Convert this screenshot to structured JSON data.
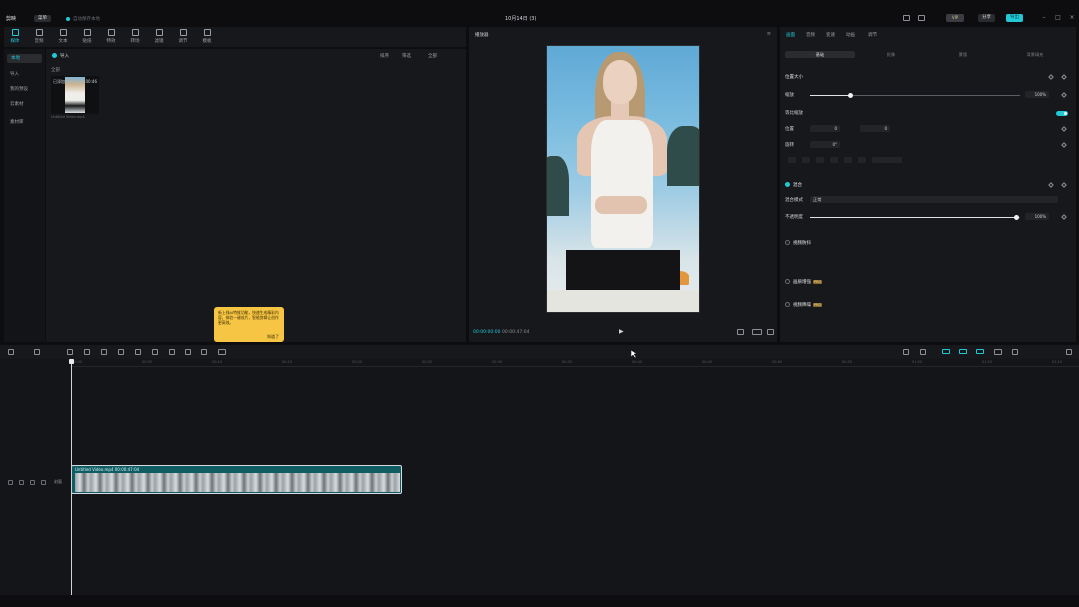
{
  "titlebar": {
    "logo": "剪映",
    "menu_label": "菜单",
    "autosave": "自动保存本地",
    "project_title": "10月14日 (3)",
    "pro_badge": "VIP",
    "share_label": "分享",
    "export_label": "导出"
  },
  "toolbar": {
    "tools": [
      {
        "label": "媒体",
        "icon": "media-icon"
      },
      {
        "label": "音频",
        "icon": "audio-icon"
      },
      {
        "label": "文本",
        "icon": "text-icon"
      },
      {
        "label": "贴纸",
        "icon": "sticker-icon"
      },
      {
        "label": "特效",
        "icon": "effects-icon"
      },
      {
        "label": "转场",
        "icon": "transition-icon"
      },
      {
        "label": "滤镜",
        "icon": "filter-icon"
      },
      {
        "label": "调节",
        "icon": "adjust-icon"
      },
      {
        "label": "模板",
        "icon": "template-icon"
      }
    ]
  },
  "media_side": {
    "items": [
      "本地",
      "导入",
      "我的预设",
      "云素材",
      "素材库"
    ]
  },
  "media": {
    "import_label": "导入",
    "tools": [
      "排序",
      "筛选",
      "全部"
    ],
    "filter_label": "全部",
    "thumb_added": "已添加",
    "thumb_duration": "00:46",
    "file_name": "Untitled Video.mp4"
  },
  "tooltip": {
    "text": "新上线AI特效功能，快速生成精彩内容，体验一键成片，智能剪辑让创作更高效。",
    "ok_label": "知道了"
  },
  "player": {
    "title": "播放器",
    "timecode_current": "00:00:00:00",
    "timecode_total": "00:00:47:04"
  },
  "inspector": {
    "tabs": [
      "画面",
      "音频",
      "变速",
      "动画",
      "调节"
    ],
    "subtabs": [
      "基础",
      "抠像",
      "蒙版",
      "背景填充"
    ],
    "position_size": "位置大小",
    "scale_label": "缩放",
    "scale_value": "100%",
    "uniform_label": "等比缩放",
    "position_label": "位置",
    "pos_x": "0",
    "pos_y": "0",
    "rotate_label": "旋转",
    "rotate_value": "0°",
    "blend_label": "混合",
    "blend_mode_label": "混合模式",
    "blend_mode_value": "正常",
    "opacity_label": "不透明度",
    "opacity_value": "100%",
    "stabilize_label": "视频防抖",
    "enhance_label": "画质增强",
    "denoise_label": "视频降噪",
    "pro_tag": "PRO"
  },
  "timeline": {
    "ticks": [
      "00:00",
      "00:05",
      "00:10",
      "00:15",
      "00:20",
      "00:25",
      "00:30",
      "00:35",
      "00:40",
      "00:45",
      "00:50",
      "00:55",
      "01:00",
      "01:05",
      "01:10"
    ],
    "cover_label": "封面",
    "clip_label": "Untitled Video.mp4  00:00:47:04"
  }
}
